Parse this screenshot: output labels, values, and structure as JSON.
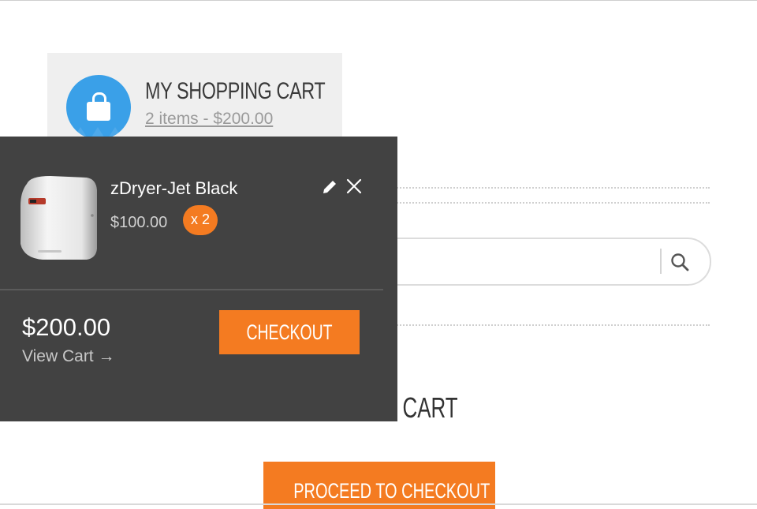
{
  "mini_cart_header": {
    "title": "MY SHOPPING CART",
    "summary": "2 items - $200.00",
    "icon": "shopping-bag-icon"
  },
  "mini_cart": {
    "items": [
      {
        "name": "zDryer-Jet Black",
        "price": "$100.00",
        "quantity": "x 2"
      }
    ],
    "total": "$200.00",
    "view_cart": "View Cart →",
    "checkout_label": "CHECKOUT"
  },
  "background_page": {
    "heading_fragment": "S CART",
    "proceed_label": "PROCEED TO CHECKOUT",
    "search_icon": "search-icon"
  },
  "colors": {
    "accent": "#f47b21",
    "cart_icon_bg": "#3aa0e8",
    "dropdown_bg": "#424242"
  }
}
